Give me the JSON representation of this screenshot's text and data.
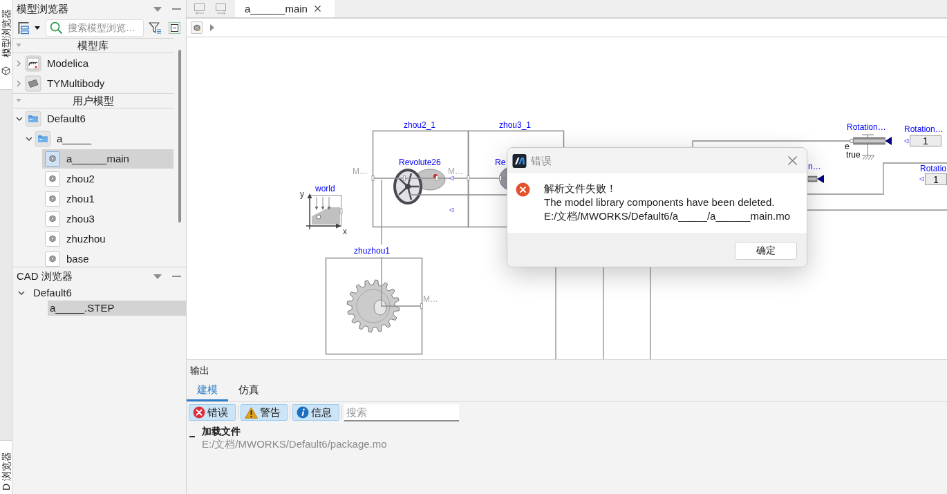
{
  "side_tabs": [
    {
      "label": "模型浏览器"
    },
    {
      "label": "D 浏览器"
    }
  ],
  "model_browser": {
    "title": "模型浏览器",
    "search": {
      "placeholder": "搜索模型浏览…"
    },
    "sections": [
      {
        "title": "模型库",
        "expanded": true,
        "items": [
          {
            "label": "Modelica",
            "kind": "library",
            "expanded": false,
            "selected": false
          },
          {
            "label": "TYMultibody",
            "kind": "library",
            "expanded": false,
            "selected": false
          }
        ]
      },
      {
        "title": "用户模型",
        "expanded": true,
        "items": [
          {
            "label": "Default6",
            "kind": "package",
            "expanded": true,
            "selected": false,
            "children": [
              {
                "label": "a_____",
                "kind": "package",
                "expanded": true,
                "selected": false,
                "children": [
                  {
                    "label": "a______main",
                    "kind": "model",
                    "selected": true
                  },
                  {
                    "label": "zhou2",
                    "kind": "model",
                    "selected": false
                  },
                  {
                    "label": "zhou1",
                    "kind": "model",
                    "selected": false
                  },
                  {
                    "label": "zhou3",
                    "kind": "model",
                    "selected": false
                  },
                  {
                    "label": "zhuzhou",
                    "kind": "model",
                    "selected": false
                  },
                  {
                    "label": "base",
                    "kind": "model",
                    "selected": false
                  }
                ]
              }
            ]
          }
        ]
      }
    ]
  },
  "cad_browser": {
    "title": "CAD 浏览器",
    "items": [
      {
        "label": "Default6",
        "expanded": true,
        "selected": false,
        "children": [
          {
            "label": "a_____.STEP",
            "selected": true
          }
        ]
      }
    ]
  },
  "editor": {
    "tabs": [
      {
        "label": "a______main",
        "selected": true
      }
    ],
    "diagram": {
      "labels": [
        {
          "text": "zhou2_1",
          "kind": "name"
        },
        {
          "text": "zhou3_1",
          "kind": "name"
        },
        {
          "text": "Rotation…",
          "kind": "name"
        },
        {
          "text": "Rotation…",
          "kind": "name"
        },
        {
          "text": "1",
          "kind": "value"
        },
        {
          "text": "e",
          "kind": "plain"
        },
        {
          "text": "true",
          "kind": "plain"
        },
        {
          "text": "Revolute26",
          "kind": "name"
        },
        {
          "text": "Re",
          "kind": "name"
        },
        {
          "text": "n…",
          "kind": "name"
        },
        {
          "text": "Rotatio",
          "kind": "name"
        },
        {
          "text": "M…",
          "kind": "port"
        },
        {
          "text": "M…",
          "kind": "port"
        },
        {
          "text": "1",
          "kind": "value"
        },
        {
          "text": "world",
          "kind": "name"
        },
        {
          "text": "y",
          "kind": "axis"
        },
        {
          "text": "x",
          "kind": "axis"
        },
        {
          "text": "zhuzhou1",
          "kind": "name"
        },
        {
          "text": "M…",
          "kind": "port"
        }
      ]
    }
  },
  "dialog": {
    "title": "错误",
    "heading": "解析文件失败！",
    "message": "The model library components have been deleted.",
    "path": "E:/文档/MWORKS/Default6/a_____/a______main.mo",
    "buttons": [
      "确定"
    ]
  },
  "output": {
    "title": "输出",
    "tabs": [
      {
        "label": "建模",
        "selected": true
      },
      {
        "label": "仿真",
        "selected": false
      }
    ],
    "filters": [
      {
        "label": "错误",
        "kind": "error",
        "on": true
      },
      {
        "label": "警告",
        "kind": "warning",
        "on": true
      },
      {
        "label": "信息",
        "kind": "info",
        "on": true
      }
    ],
    "search": {
      "placeholder": "搜索"
    },
    "log": [
      {
        "title": "加载文件",
        "detail": "E:/文档/MWORKS/Default6/package.mo",
        "expanded": true
      }
    ]
  }
}
